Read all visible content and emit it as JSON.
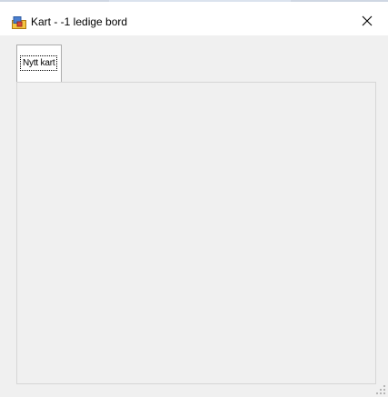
{
  "window": {
    "title": "Kart - -1 ledige bord",
    "icon": "app-window-icon",
    "close_icon": "close-icon"
  },
  "tabs": [
    {
      "label": "Nytt kart",
      "selected": true
    }
  ],
  "colors": {
    "titlebar_bg": "#ffffff",
    "client_bg": "#f0f0f0",
    "tab_border": "#acacac",
    "page_border": "#d6d6d6"
  }
}
